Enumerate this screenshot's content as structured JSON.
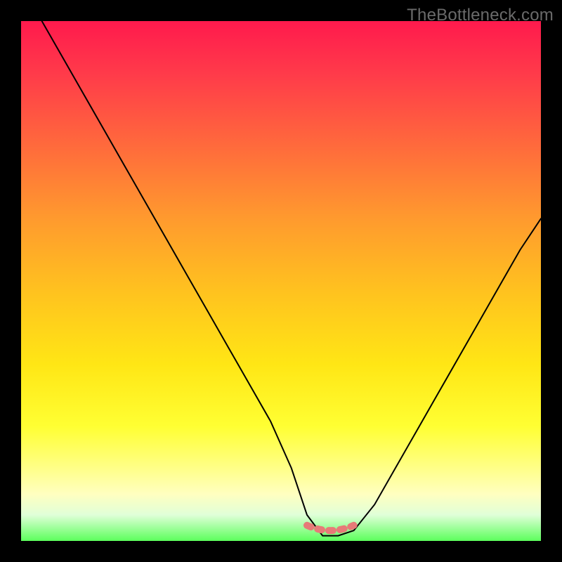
{
  "watermark": "TheBottleneck.com",
  "chart_data": {
    "type": "line",
    "title": "",
    "xlabel": "",
    "ylabel": "",
    "xlim": [
      0,
      100
    ],
    "ylim": [
      0,
      100
    ],
    "x": [
      4,
      8,
      12,
      16,
      20,
      24,
      28,
      32,
      36,
      40,
      44,
      48,
      52,
      55,
      58,
      61,
      64,
      68,
      72,
      76,
      80,
      84,
      88,
      92,
      96,
      100
    ],
    "values": [
      100,
      93,
      86,
      79,
      72,
      65,
      58,
      51,
      44,
      37,
      30,
      23,
      14,
      5,
      1,
      1,
      2,
      7,
      14,
      21,
      28,
      35,
      42,
      49,
      56,
      62
    ],
    "valley_marker": {
      "x_range": [
        55,
        64
      ],
      "y": 3,
      "color": "#e77a78"
    },
    "background_gradient": {
      "top": "#ff1a4d",
      "mid": "#ffe615",
      "bottom": "#5cff5c"
    }
  }
}
